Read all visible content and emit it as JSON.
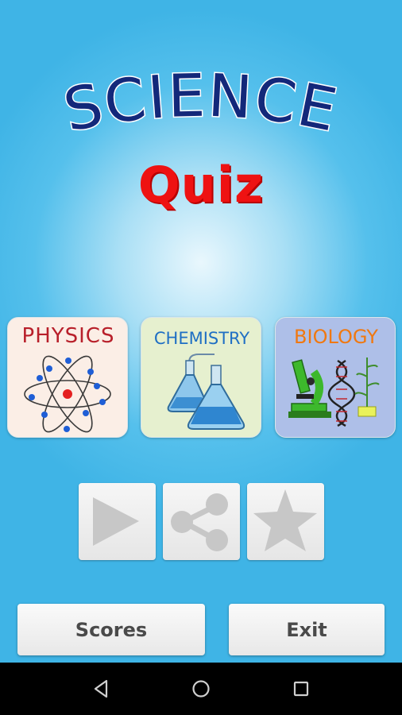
{
  "app": {
    "title_main": "SCIENCE",
    "title_sub": "Quiz"
  },
  "subjects": [
    {
      "label": "PHYSICS"
    },
    {
      "label": "CHEMISTRY"
    },
    {
      "label": "BIOLOGY"
    }
  ],
  "action_icons": [
    "play-icon",
    "share-icon",
    "star-icon"
  ],
  "buttons": {
    "scores_label": "Scores",
    "exit_label": "Exit"
  },
  "navigation_bar": [
    "back-icon",
    "home-icon",
    "recents-icon"
  ],
  "colors": {
    "title_main": "#13287a",
    "title_sub": "#ee1212",
    "background": "#3fb4e6"
  }
}
